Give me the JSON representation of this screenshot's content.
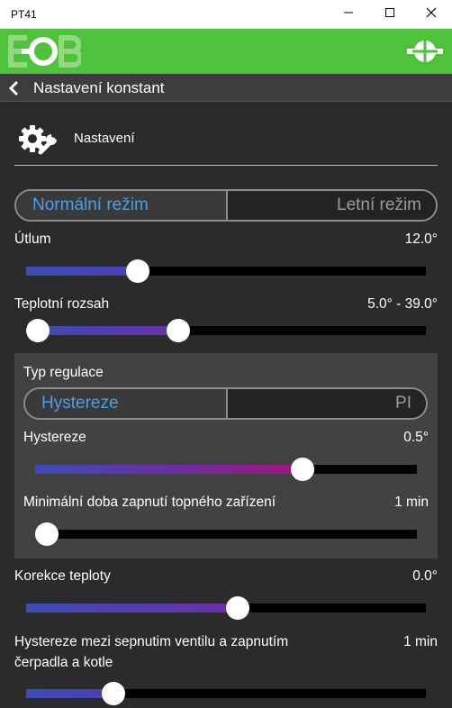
{
  "window": {
    "title": "PT41"
  },
  "nav": {
    "title": "Nastavení konstant"
  },
  "section": {
    "title": "Nastavení"
  },
  "mode_toggle": {
    "active": "Normální režim",
    "inactive": "Letní režim"
  },
  "sliders": {
    "utlum": {
      "label": "Útlum",
      "value": "12.0°",
      "level": 0.25
    },
    "rozsah": {
      "label": "Teplotní rozsah",
      "value": "5.0° - 39.0°",
      "low": 0.03,
      "high": 0.38
    },
    "hystereze": {
      "label": "Hystereze",
      "value": "0.5°",
      "level": 0.67
    },
    "min_doba": {
      "label": "Minimální doba zapnutí topného zařízení",
      "value": "1 min",
      "level": 0.0
    },
    "korekce": {
      "label": "Korekce teploty",
      "value": "0.0°",
      "level": 0.5
    },
    "hyst_ventil": {
      "label_line1": "Hystereze mezi sepnutim ventilu a zapnutím",
      "label_line2": "čerpadla a kotle",
      "value": "1 min",
      "level": 0.19
    }
  },
  "regulation": {
    "title": "Typ regulace",
    "active": "Hystereze",
    "inactive": "PI"
  },
  "colors": {
    "green": "#4ec23a",
    "accent": "#4a9fe8",
    "fill_start": "#3d4bb8",
    "fill_mid": "#6a2fa8",
    "fill_end": "#a6157e"
  }
}
